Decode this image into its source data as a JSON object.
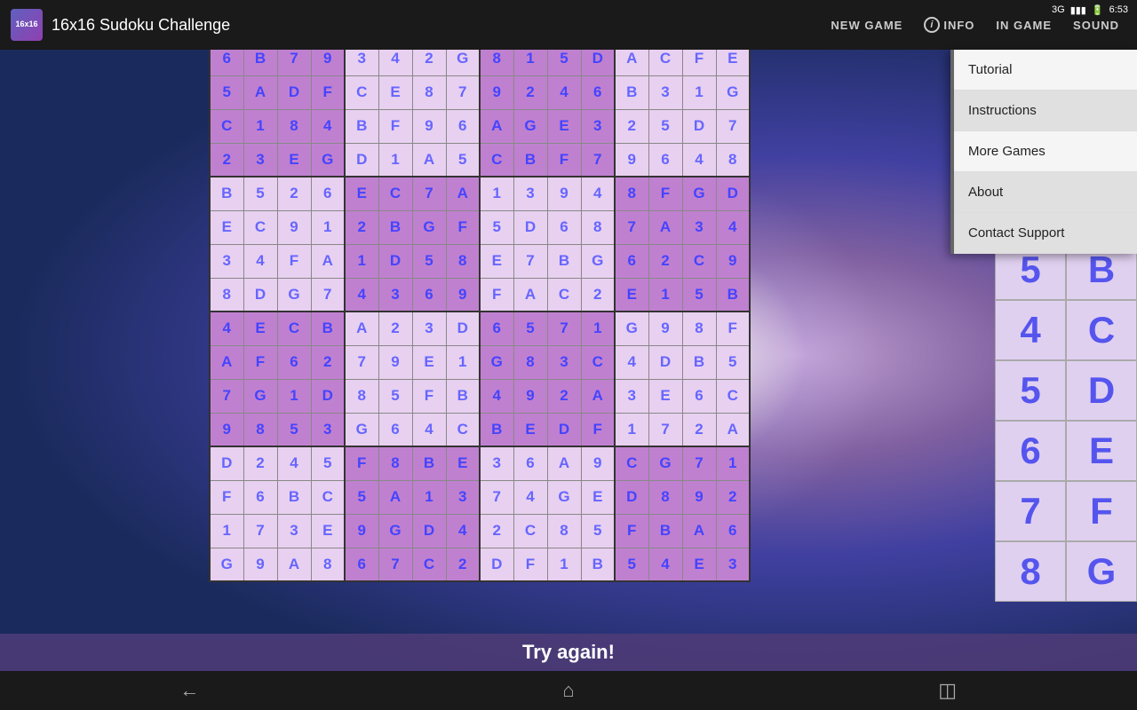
{
  "app": {
    "icon_text": "16x16",
    "title": "16x16 Sudoku Challenge"
  },
  "statusbar": {
    "signal": "3G",
    "battery": "▮▮▮",
    "time": "6:53"
  },
  "topbar": {
    "new_game": "NEW GAME",
    "info": "INFO",
    "in_game": "IN GAME",
    "sound": "SOUND"
  },
  "grid": {
    "rows": [
      [
        "6",
        "B",
        "7",
        "9",
        "3",
        "4",
        "2",
        "G",
        "8",
        "1",
        "5",
        "D",
        "A",
        "C",
        "F",
        "E"
      ],
      [
        "5",
        "A",
        "D",
        "F",
        "C",
        "E",
        "8",
        "7",
        "9",
        "2",
        "4",
        "6",
        "B",
        "3",
        "1",
        "G"
      ],
      [
        "C",
        "1",
        "8",
        "4",
        "B",
        "F",
        "9",
        "6",
        "A",
        "G",
        "E",
        "3",
        "2",
        "5",
        "D",
        "7"
      ],
      [
        "2",
        "3",
        "E",
        "G",
        "D",
        "1",
        "A",
        "5",
        "C",
        "B",
        "F",
        "7",
        "9",
        "6",
        "4",
        "8"
      ],
      [
        "B",
        "5",
        "2",
        "6",
        "E",
        "C",
        "7",
        "A",
        "1",
        "3",
        "9",
        "4",
        "8",
        "F",
        "G",
        "D"
      ],
      [
        "E",
        "C",
        "9",
        "1",
        "2",
        "B",
        "G",
        "F",
        "5",
        "D",
        "6",
        "8",
        "7",
        "A",
        "3",
        "4"
      ],
      [
        "3",
        "4",
        "F",
        "A",
        "1",
        "D",
        "5",
        "8",
        "E",
        "7",
        "B",
        "G",
        "6",
        "2",
        "C",
        "9"
      ],
      [
        "8",
        "D",
        "G",
        "7",
        "4",
        "3",
        "6",
        "9",
        "F",
        "A",
        "C",
        "2",
        "E",
        "1",
        "5",
        "B"
      ],
      [
        "4",
        "E",
        "C",
        "B",
        "A",
        "2",
        "3",
        "D",
        "6",
        "5",
        "7",
        "1",
        "G",
        "9",
        "8",
        "F"
      ],
      [
        "A",
        "F",
        "6",
        "2",
        "7",
        "9",
        "E",
        "1",
        "G",
        "8",
        "3",
        "C",
        "4",
        "D",
        "B",
        "5"
      ],
      [
        "7",
        "G",
        "1",
        "D",
        "8",
        "5",
        "F",
        "B",
        "4",
        "9",
        "2",
        "A",
        "3",
        "E",
        "6",
        "C"
      ],
      [
        "9",
        "8",
        "5",
        "3",
        "G",
        "6",
        "4",
        "C",
        "B",
        "E",
        "D",
        "F",
        "1",
        "7",
        "2",
        "A"
      ],
      [
        "D",
        "2",
        "4",
        "5",
        "F",
        "8",
        "B",
        "E",
        "3",
        "6",
        "A",
        "9",
        "C",
        "G",
        "7",
        "1"
      ],
      [
        "F",
        "6",
        "B",
        "C",
        "5",
        "A",
        "1",
        "3",
        "7",
        "4",
        "G",
        "E",
        "D",
        "8",
        "9",
        "2"
      ],
      [
        "1",
        "7",
        "3",
        "E",
        "9",
        "G",
        "D",
        "4",
        "2",
        "C",
        "8",
        "5",
        "F",
        "B",
        "A",
        "6"
      ],
      [
        "G",
        "9",
        "A",
        "8",
        "6",
        "7",
        "C",
        "2",
        "D",
        "F",
        "1",
        "B",
        "5",
        "4",
        "E",
        "3"
      ]
    ]
  },
  "number_panel": {
    "buttons": [
      "5",
      "B",
      "4",
      "C",
      "5",
      "D",
      "6",
      "E",
      "7",
      "F",
      "8",
      "G"
    ]
  },
  "dropdown": {
    "items": [
      {
        "label": "Tutorial"
      },
      {
        "label": "Instructions"
      },
      {
        "label": "More Games"
      },
      {
        "label": "About"
      },
      {
        "label": "Contact Support"
      }
    ]
  },
  "banner": {
    "text": "Try again!"
  },
  "nav": {
    "back": "←",
    "home": "⬜",
    "recent": "▣"
  }
}
